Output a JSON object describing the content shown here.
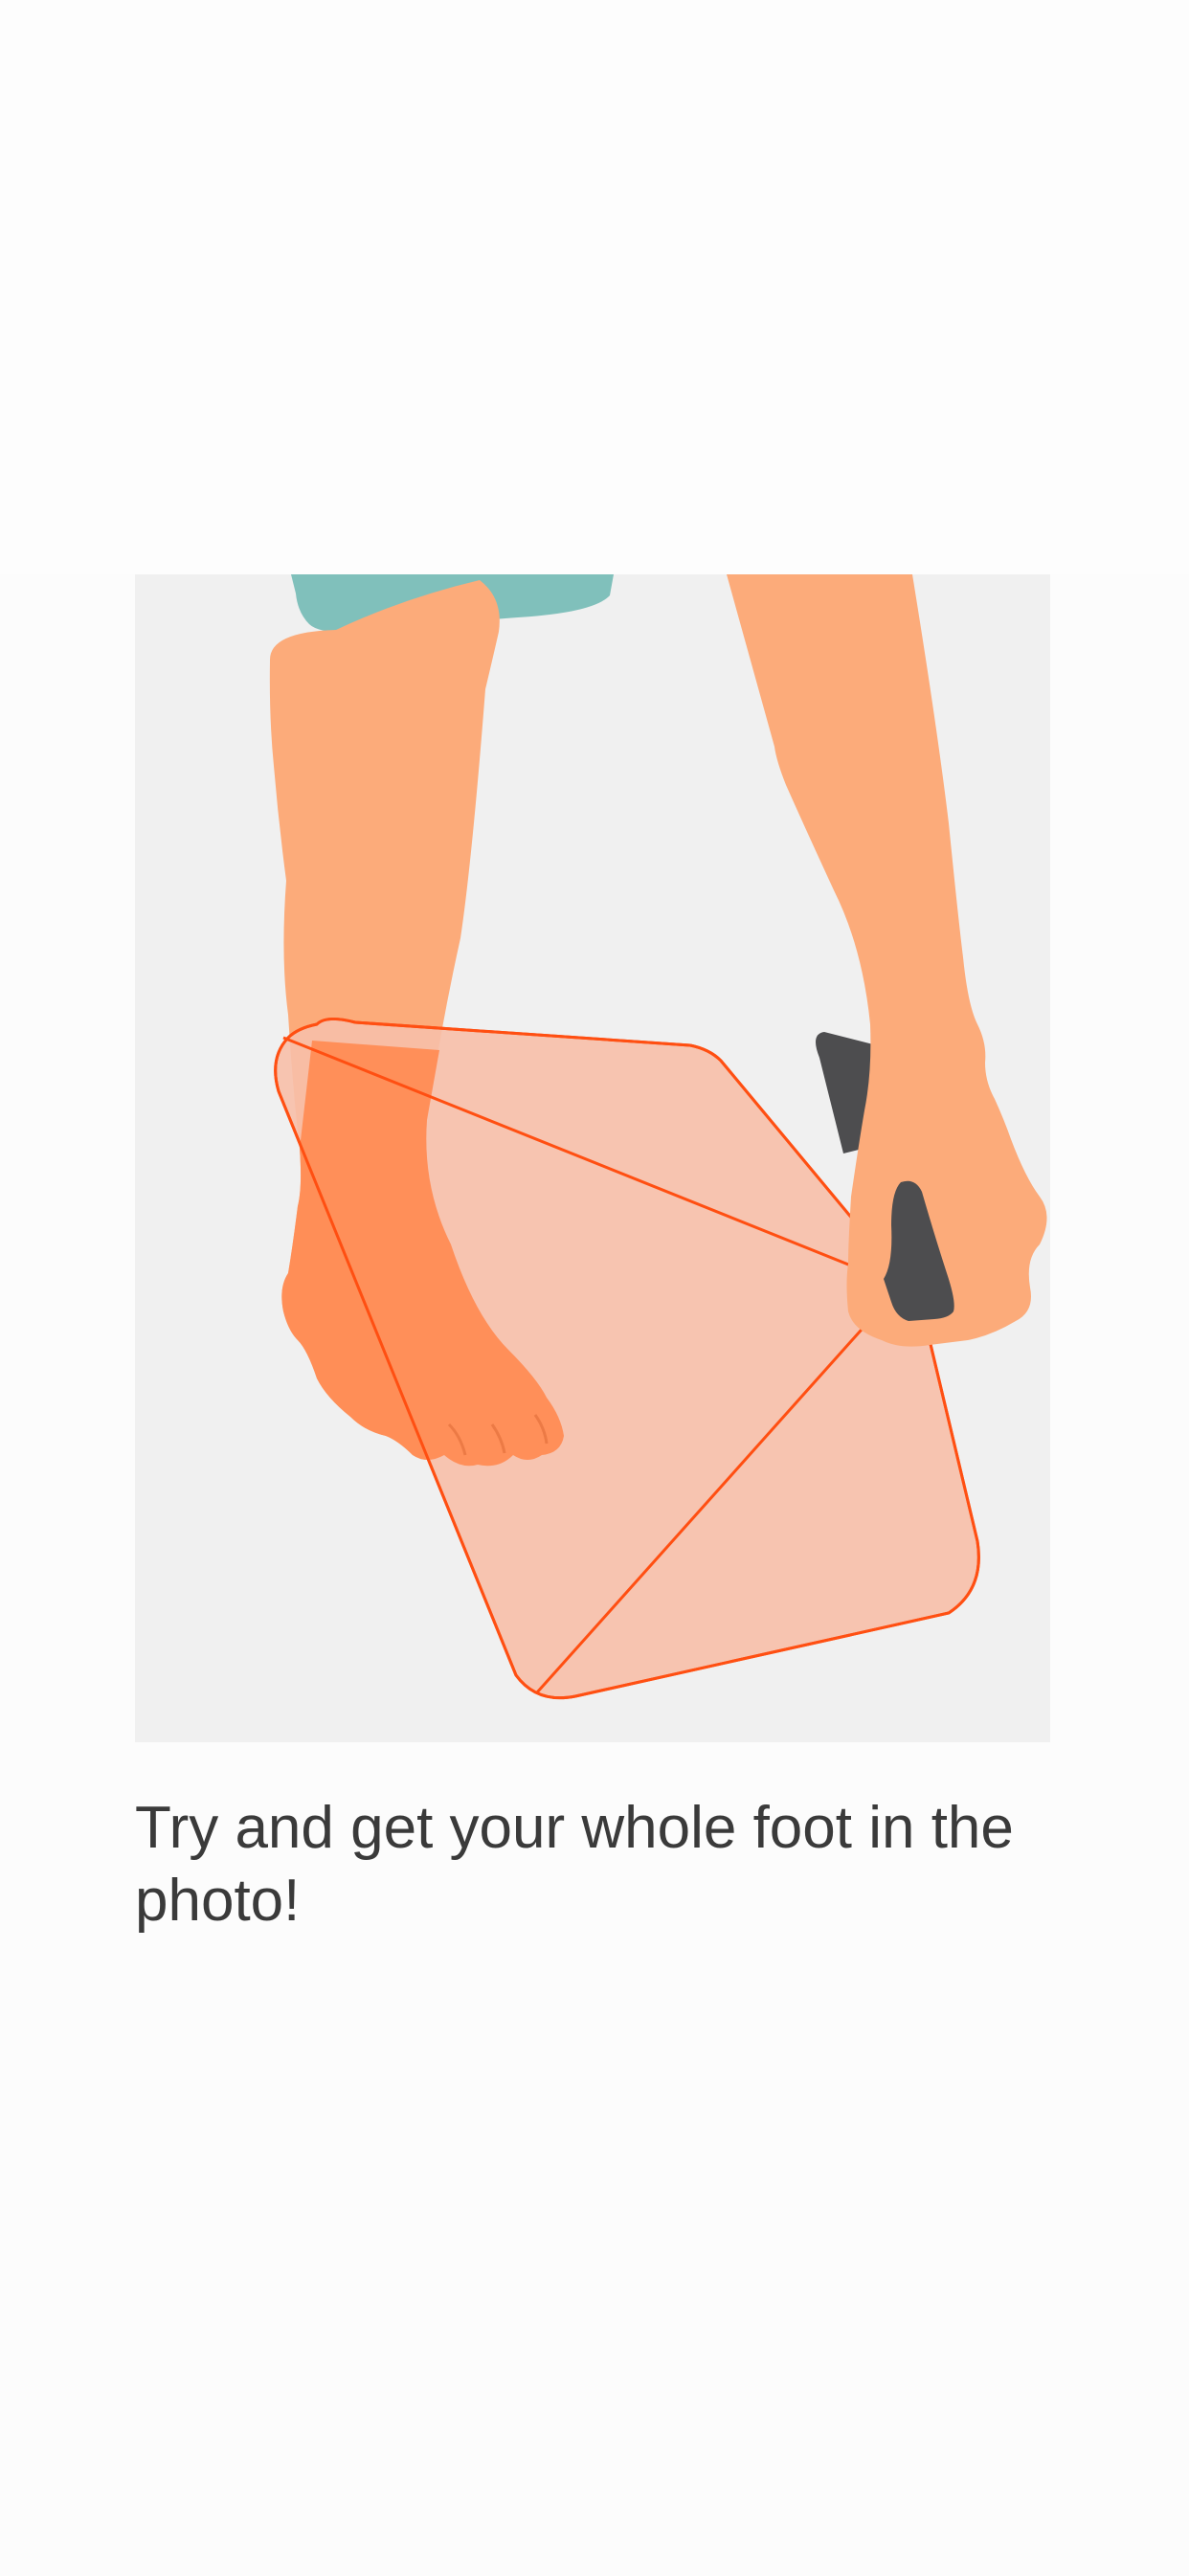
{
  "instruction": {
    "text": "Try and get your whole foot in the photo!"
  },
  "illustration": {
    "icons": [
      "leg-with-foot-icon",
      "hand-holding-phone-icon",
      "phone-frame-icon"
    ],
    "colors": {
      "panel_background": "#f0f0f0",
      "skin": "#fcab7a",
      "skin_overlap": "#ff8c55",
      "frame_fill": "#f7bfa8",
      "frame_stroke": "#ff4f12",
      "shorts": "#80c0bb",
      "phone": "#4d4d4f",
      "text": "#3a3a3a"
    }
  }
}
